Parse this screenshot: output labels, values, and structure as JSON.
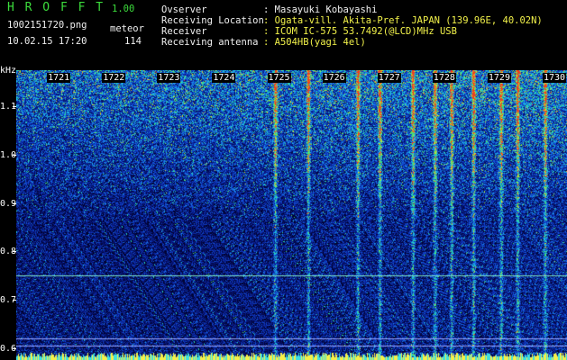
{
  "app": {
    "title": "H R O F F T",
    "version": "1.00",
    "file": "1002151720.png",
    "datetime": "10.02.15 17:20",
    "counter_label": "meteor",
    "counter_value": "114"
  },
  "info": {
    "labels": [
      "Ovserver",
      "Receiving Location",
      "Receiver",
      "Receiving antenna"
    ],
    "values": [
      ": Masayuki Kobayashi",
      ": Ogata-vill. Akita-Pref. JAPAN (139.96E, 40.02N)",
      ": ICOM IC-575 53.7492(@LCD)MHz USB",
      ": A504HB(yagi 4el)"
    ]
  },
  "chart_data": {
    "type": "heatmap",
    "ylabel": "kHz",
    "x_ticks": [
      "1721",
      "1722",
      "1723",
      "1724",
      "1725",
      "1726",
      "1727",
      "1728",
      "1729",
      "1730"
    ],
    "y_ticks": [
      "1.1",
      "1.0",
      "0.9",
      "0.8",
      "0.7",
      "0.6"
    ],
    "y_tick_values": [
      1.1,
      1.0,
      0.9,
      0.8,
      0.7,
      0.6
    ],
    "ylim": [
      0.575,
      1.175
    ],
    "xlim": [
      17.2,
      17.3
    ],
    "carrier_lines_khz": [
      0.75,
      0.62,
      0.605
    ],
    "meteor_trails_minute": [
      17.247,
      17.253,
      17.262,
      17.266,
      17.272,
      17.276,
      17.279,
      17.283,
      17.288,
      17.291,
      17.296
    ]
  }
}
